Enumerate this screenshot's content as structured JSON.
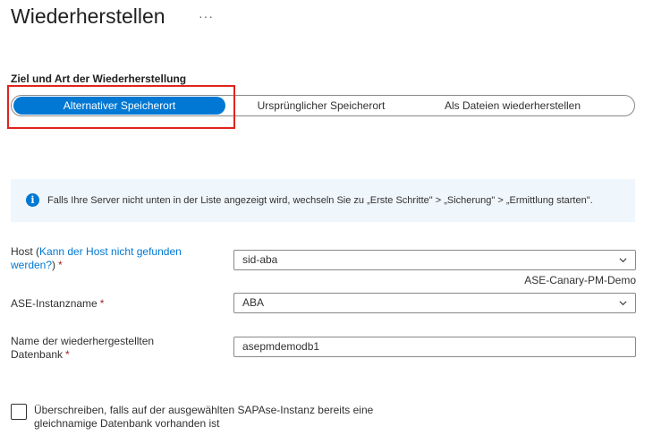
{
  "header": {
    "title": "Wiederherstellen",
    "more_label": "···"
  },
  "restore": {
    "section_label": "Ziel und Art der Wiederherstellung",
    "options": [
      {
        "label": "Alternativer Speicherort",
        "selected": true
      },
      {
        "label": "Ursprünglicher Speicherort",
        "selected": false
      },
      {
        "label": "Als Dateien wiederherstellen",
        "selected": false
      }
    ]
  },
  "info": {
    "icon": "info-icon",
    "text": "Falls Ihre Server nicht unten in der Liste angezeigt wird, wechseln Sie zu „Erste Schritte\" > „Sicherung\" > „Ermittlung starten\"."
  },
  "form": {
    "host": {
      "label_prefix": "Host (",
      "link": "Kann der Host nicht gefunden werden?",
      "label_suffix": ")",
      "required": "*",
      "value": "sid-aba",
      "subtext": "ASE-Canary-PM-Demo"
    },
    "instance": {
      "label": "ASE-Instanzname",
      "required": "*",
      "value": "ABA"
    },
    "database": {
      "label": "Name der wiederhergestellten Datenbank",
      "required": "*",
      "value": "asepmdemodb1"
    },
    "overwrite": {
      "label": "Überschreiben, falls auf der ausgewählten SAPAse-Instanz bereits eine gleichnamige Datenbank vorhanden ist",
      "checked": false
    }
  },
  "colors": {
    "accent": "#0078d4",
    "highlight": "#e0231e",
    "required": "#a4262c",
    "info_bg": "#eff6fc"
  }
}
